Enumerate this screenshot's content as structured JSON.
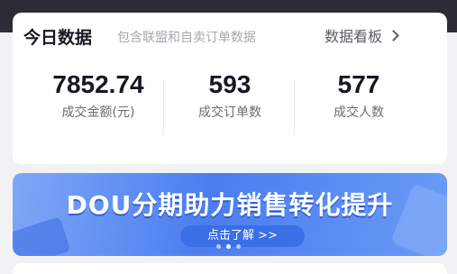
{
  "today": {
    "title": "今日数据",
    "subtitle": "包含联盟和自卖订单数据",
    "dashboard_link": "数据看板",
    "metrics": [
      {
        "value": "7852.74",
        "label": "成交金额(元)"
      },
      {
        "value": "593",
        "label": "成交订单数"
      },
      {
        "value": "577",
        "label": "成交人数"
      }
    ]
  },
  "banner": {
    "title": "DOU分期助力销售转化提升",
    "cta": "点击了解 >>",
    "slide_count": 3,
    "active_slide": 1
  },
  "colors": {
    "banner_blue": "#4b7df0",
    "text_primary": "#161823",
    "text_secondary": "#a7a8ad"
  },
  "icons": [
    "chevron-right-icon"
  ]
}
